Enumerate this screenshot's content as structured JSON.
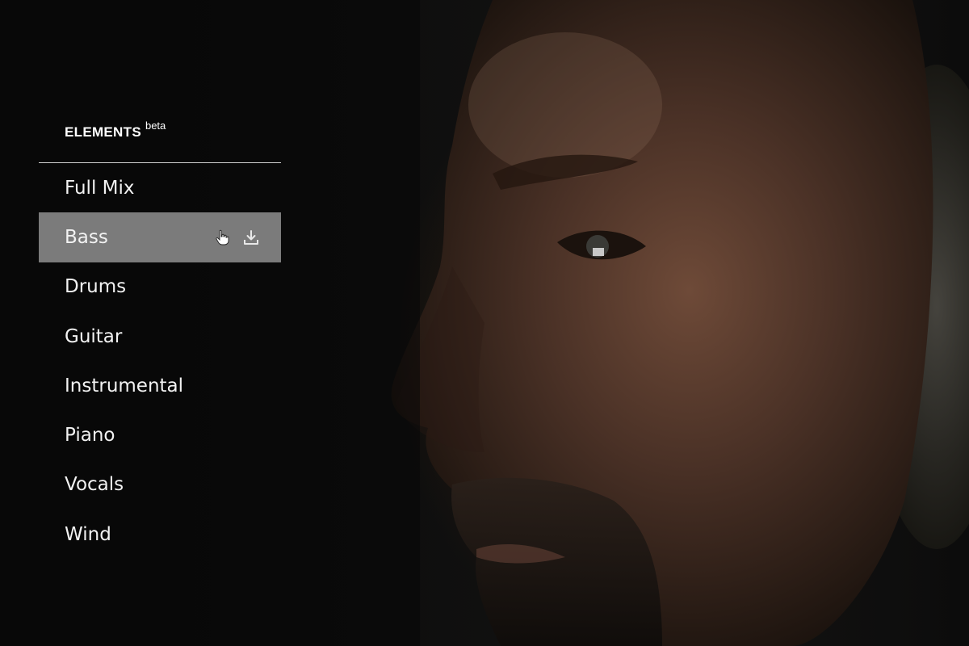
{
  "brand": {
    "name": "ELEMENTS",
    "tag": "beta"
  },
  "menu": {
    "items": [
      {
        "label": "Full Mix",
        "active": false
      },
      {
        "label": "Bass",
        "active": true
      },
      {
        "label": "Drums",
        "active": false
      },
      {
        "label": "Guitar",
        "active": false
      },
      {
        "label": "Instrumental",
        "active": false
      },
      {
        "label": "Piano",
        "active": false
      },
      {
        "label": "Vocals",
        "active": false
      },
      {
        "label": "Wind",
        "active": false
      }
    ]
  },
  "icons": {
    "cursor": "hand-pointer-icon",
    "download": "download-icon"
  },
  "colors": {
    "active_row": "#7b7b7b",
    "text": "#f2f2f2",
    "divider": "#cfcfcf"
  }
}
